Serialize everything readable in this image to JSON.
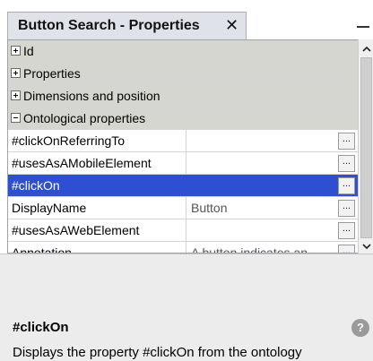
{
  "tab": {
    "title": "Button Search - Properties",
    "close_glyph": "✕"
  },
  "categories": {
    "id": "Id",
    "properties": "Properties",
    "dimensions": "Dimensions and position",
    "ontological": "Ontological properties"
  },
  "rows": [
    {
      "name": "#clickOnReferringTo",
      "value": ""
    },
    {
      "name": "#usesAsAMobileElement",
      "value": ""
    },
    {
      "name": "#clickOn",
      "value": ""
    },
    {
      "name": "DisplayName",
      "value": "Button"
    },
    {
      "name": "#usesAsAWebElement",
      "value": ""
    },
    {
      "name": "Annotation",
      "value": "A button indicates an..."
    }
  ],
  "ellipsis": "...",
  "description": {
    "title": "#clickOn",
    "text": "Displays the property #clickOn from the ontology"
  },
  "icons": {
    "close": "close-icon",
    "minimize": "minimize-icon",
    "expand": "plus-box-icon",
    "collapse": "minus-box-icon",
    "help": "help-icon"
  },
  "colors": {
    "selected_row": "#2f4fd3",
    "category_row": "#d6d6d0",
    "tab_bg": "#dfe2e9"
  }
}
